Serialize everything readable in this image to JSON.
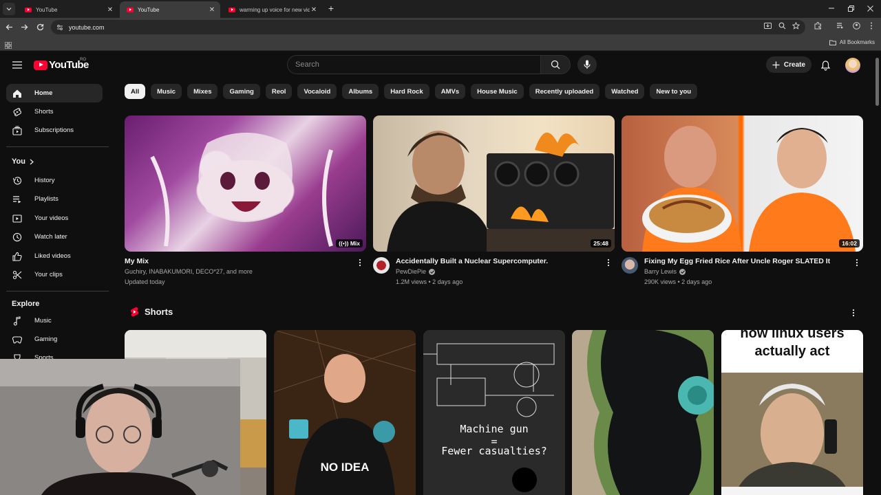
{
  "browser": {
    "tabs": [
      {
        "title": "YouTube",
        "active": false
      },
      {
        "title": "YouTube",
        "active": true
      },
      {
        "title": "warming up voice for new vide",
        "active": false
      }
    ],
    "url": "youtube.com",
    "bookmarks_label": "All Bookmarks"
  },
  "header": {
    "logo_text": "YouTube",
    "region": "RO",
    "search_placeholder": "Search",
    "create_label": "Create"
  },
  "sidebar": {
    "main": [
      {
        "label": "Home",
        "icon": "home-icon",
        "active": true
      },
      {
        "label": "Shorts",
        "icon": "shorts-icon"
      },
      {
        "label": "Subscriptions",
        "icon": "subscriptions-icon"
      }
    ],
    "you_heading": "You",
    "you": [
      {
        "label": "History",
        "icon": "history-icon"
      },
      {
        "label": "Playlists",
        "icon": "playlists-icon"
      },
      {
        "label": "Your videos",
        "icon": "your-videos-icon"
      },
      {
        "label": "Watch later",
        "icon": "watch-later-icon"
      },
      {
        "label": "Liked videos",
        "icon": "like-icon"
      },
      {
        "label": "Your clips",
        "icon": "clips-icon"
      }
    ],
    "explore_heading": "Explore",
    "explore": [
      {
        "label": "Music",
        "icon": "music-icon"
      },
      {
        "label": "Gaming",
        "icon": "gaming-icon"
      },
      {
        "label": "Sports",
        "icon": "sports-icon"
      }
    ]
  },
  "chips": [
    "All",
    "Music",
    "Mixes",
    "Gaming",
    "Reol",
    "Vocaloid",
    "Albums",
    "Hard Rock",
    "AMVs",
    "House Music",
    "Recently uploaded",
    "Watched",
    "New to you"
  ],
  "videos": [
    {
      "title": "My Mix",
      "line1": "Guchiry, INABAKUMORI, DECO*27, and more",
      "line2": "Updated today",
      "badge": "Mix"
    },
    {
      "title": "Accidentally Built a Nuclear Supercomputer.",
      "channel": "PewDiePie",
      "stats": "1.2M views • 2 days ago",
      "duration": "25:48"
    },
    {
      "title": "Fixing My Egg Fried Rice After Uncle Roger SLATED It",
      "channel": "Barry Lewis",
      "stats": "290K views • 2 days ago",
      "duration": "16:02"
    }
  ],
  "shorts": {
    "heading": "Shorts",
    "items": [
      {
        "overlay": ""
      },
      {
        "overlay": "NO IDEA"
      },
      {
        "overlay_line1": "Machine gun",
        "overlay_line2": "=",
        "overlay_line3": "Fewer casualties?"
      },
      {
        "overlay": ""
      },
      {
        "overlay_line1": "how linux users",
        "overlay_line2": "actually act"
      }
    ]
  },
  "colors": {
    "accent": "#ff0033",
    "background": "#0f0f0f",
    "chip": "#272727"
  }
}
